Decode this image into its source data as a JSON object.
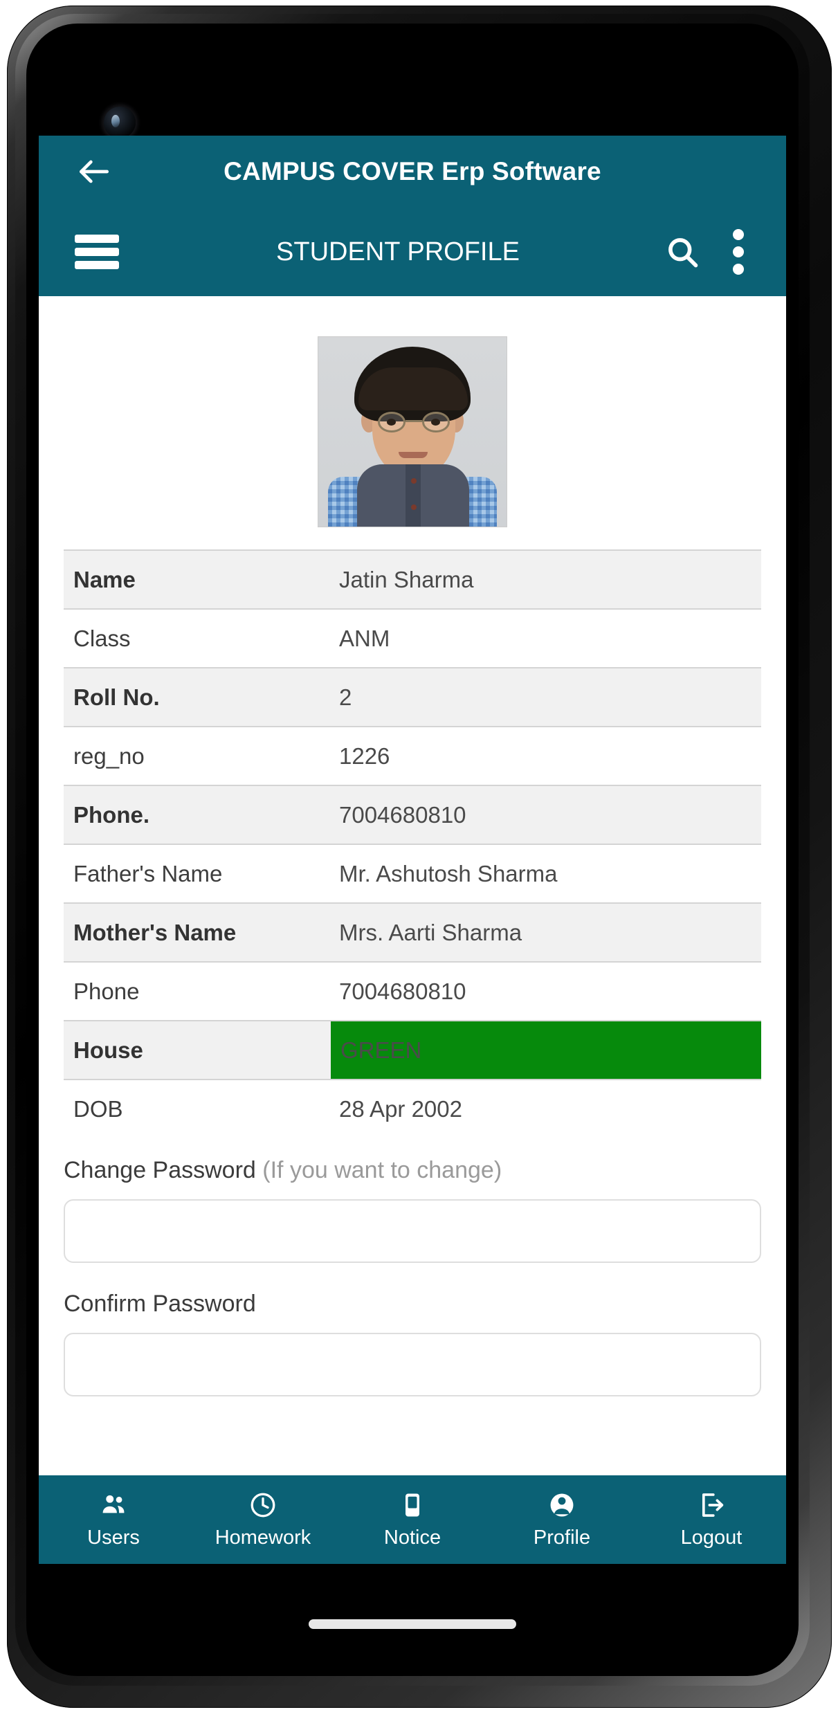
{
  "app": {
    "title": "CAMPUS COVER Erp Software",
    "section_title": "STUDENT PROFILE",
    "accent_color": "#0b6175",
    "house_color": "#068a0c"
  },
  "appbar": {
    "back_label": "Back",
    "menu_label": "Menu",
    "search_label": "Search",
    "overflow_label": "More options"
  },
  "profile": {
    "photo_alt": "Student photo"
  },
  "table": {
    "rows": [
      {
        "label": "Name",
        "value": "Jatin Sharma",
        "shaded": true,
        "highlight": false
      },
      {
        "label": "Class",
        "value": "ANM",
        "shaded": false,
        "highlight": false
      },
      {
        "label": "Roll No.",
        "value": "2",
        "shaded": true,
        "highlight": false
      },
      {
        "label": "reg_no",
        "value": "1226",
        "shaded": false,
        "highlight": false
      },
      {
        "label": "Phone.",
        "value": "7004680810",
        "shaded": true,
        "highlight": false
      },
      {
        "label": "Father's Name",
        "value": "Mr. Ashutosh Sharma",
        "shaded": false,
        "highlight": false
      },
      {
        "label": "Mother's Name",
        "value": "Mrs. Aarti Sharma",
        "shaded": true,
        "highlight": false
      },
      {
        "label": "Phone",
        "value": "7004680810",
        "shaded": false,
        "highlight": false
      },
      {
        "label": "House",
        "value": "GREEN",
        "shaded": true,
        "highlight": true
      },
      {
        "label": "DOB",
        "value": "28 Apr 2002",
        "shaded": false,
        "highlight": false
      }
    ]
  },
  "password": {
    "change_label": "Change Password",
    "change_hint": "(If you want to change)",
    "change_value": "",
    "change_placeholder": "",
    "confirm_label": "Confirm Password",
    "confirm_value": "",
    "confirm_placeholder": ""
  },
  "bottomnav": {
    "items": [
      {
        "icon": "users-icon",
        "label": "Users"
      },
      {
        "icon": "clock-icon",
        "label": "Homework"
      },
      {
        "icon": "notice-icon",
        "label": "Notice"
      },
      {
        "icon": "person-icon",
        "label": "Profile"
      },
      {
        "icon": "logout-icon",
        "label": "Logout"
      }
    ]
  }
}
